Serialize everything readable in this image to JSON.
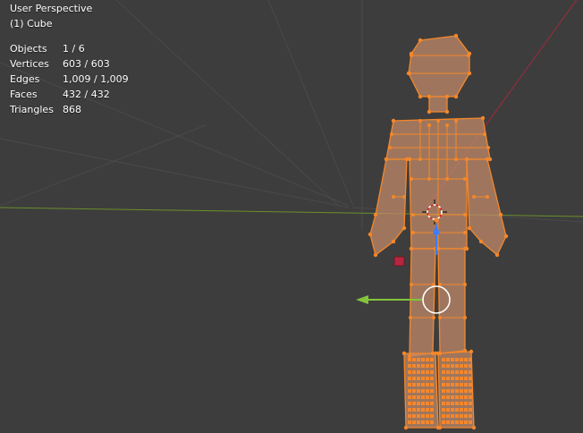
{
  "viewport": {
    "view_name": "User Perspective",
    "object_name": "(1) Cube"
  },
  "stats": [
    {
      "label": "Objects",
      "value": "1 / 6"
    },
    {
      "label": "Vertices",
      "value": "603 / 603"
    },
    {
      "label": "Edges",
      "value": "1,009 / 1,009"
    },
    {
      "label": "Faces",
      "value": "432 / 432"
    },
    {
      "label": "Triangles",
      "value": "868"
    }
  ],
  "colors": {
    "background": "#3d3d3d",
    "grid": "#4a4a4a",
    "x_axis": "#8b2e3e",
    "y_axis": "#6b8f2a",
    "selection": "#f5872b",
    "mesh_face": "#c08a68",
    "gizmo_x": "#84c43c",
    "gizmo_z": "#3d7cff"
  },
  "icons": [
    "3d-cursor-icon",
    "origin-point-icon",
    "move-gizmo-x-arrow-icon",
    "move-gizmo-z-arrow-icon",
    "move-gizmo-ring-icon",
    "light-object-icon"
  ]
}
